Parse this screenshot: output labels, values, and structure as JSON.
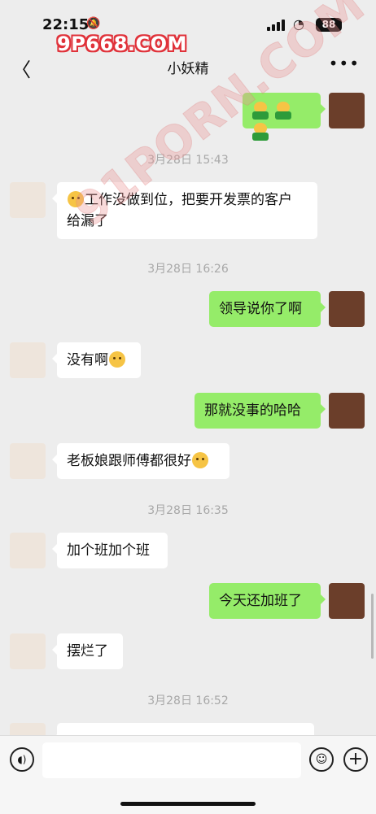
{
  "status_bar": {
    "time": "22:15",
    "battery": "88",
    "mute_icon": "bell-slash-icon",
    "wifi_icon": "wifi-icon"
  },
  "watermarks": {
    "top": "9P668.COM",
    "diagonal": "91PORN.COM"
  },
  "header": {
    "title": "小妖精",
    "back_icon": "chevron-left-icon",
    "more_icon": "ellipsis-icon"
  },
  "colors": {
    "sent_bubble": "#95ec69",
    "received_bubble": "#ffffff",
    "background": "#ededed"
  },
  "messages": [
    {
      "side": "right",
      "type": "emoji",
      "content": "frog-emoji x3"
    },
    {
      "side": "time",
      "text": "3月28日 15:43"
    },
    {
      "side": "left",
      "text": "工作没做到位，把要开发票的客户给漏了",
      "emoji": "sad-face-emoji"
    },
    {
      "side": "time",
      "text": "3月28日 16:26"
    },
    {
      "side": "right",
      "text": "领导说你了啊"
    },
    {
      "side": "left",
      "text": "没有啊",
      "emoji": "thinking-face-emoji"
    },
    {
      "side": "right",
      "text": "那就没事的哈哈"
    },
    {
      "side": "left",
      "text": "老板娘跟师傅都很好",
      "emoji": "smiling-face-emoji"
    },
    {
      "side": "time",
      "text": "3月28日 16:35"
    },
    {
      "side": "left",
      "text": "加个班加个班"
    },
    {
      "side": "right",
      "text": "今天还加班了"
    },
    {
      "side": "left",
      "text": "摆烂了"
    },
    {
      "side": "time",
      "text": "3月28日 16:52"
    },
    {
      "side": "left",
      "text": "…",
      "note": "partially visible"
    }
  ],
  "texts": {
    "m2a": "工作没做到位，把要开发票的客户",
    "m2b": "给漏了",
    "t1": "3月28日 15:43",
    "t2": "3月28日 16:26",
    "m3": "领导说你了啊",
    "m4": "没有啊",
    "m5": "那就没事的哈哈",
    "m6": "老板娘跟师傅都很好",
    "t3": "3月28日 16:35",
    "m7": "加个班加个班",
    "m8": "今天还加班了",
    "m9": "摆烂了",
    "t4": "3月28日 16:52"
  },
  "input_bar": {
    "placeholder": "",
    "voice_icon": "voice-icon",
    "emoji_icon": "emoji-icon",
    "plus_icon": "plus-icon"
  }
}
